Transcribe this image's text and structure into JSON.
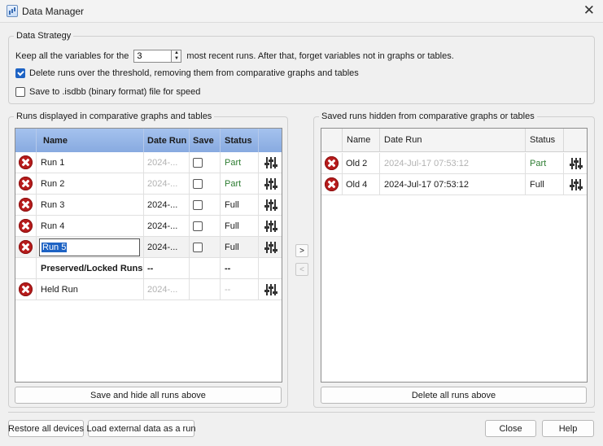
{
  "window": {
    "title": "Data Manager",
    "close": "✕"
  },
  "strategy": {
    "legend": "Data Strategy",
    "keep_prefix": "Keep all the variables for the",
    "keep_value": "3",
    "keep_suffix": "most recent runs.  After that, forget variables not in graphs or tables.",
    "delete_label": "Delete runs over the threshold, removing them from comparative graphs and tables",
    "delete_checked": true,
    "save_label": "Save to .isdbb (binary format) file for speed",
    "save_checked": false
  },
  "left": {
    "legend": "Runs displayed in comparative graphs and tables",
    "headers": {
      "name": "Name",
      "date": "Date Run",
      "save": "Save",
      "status": "Status"
    },
    "rows": [
      {
        "name": "Run 1",
        "date": "2024-...",
        "status": "Part"
      },
      {
        "name": "Run 2",
        "date": "2024-...",
        "status": "Part"
      },
      {
        "name": "Run 3",
        "date": "2024-...",
        "status": "Full"
      },
      {
        "name": "Run 4",
        "date": "2024-...",
        "status": "Full"
      },
      {
        "name": "Run 5",
        "date": "2024-...",
        "status": "Full"
      }
    ],
    "preserved": {
      "name": "Preserved/Locked Runs...",
      "date": "--",
      "status": "--"
    },
    "held": {
      "name": "Held Run",
      "date": "2024-...",
      "status": "--"
    },
    "button": "Save and hide all runs above"
  },
  "transfer": {
    "right": ">",
    "left": "<"
  },
  "right": {
    "legend": "Saved runs hidden from comparative graphs or tables",
    "headers": {
      "name": "Name",
      "date": "Date Run",
      "status": "Status"
    },
    "rows": [
      {
        "name": "Old 2",
        "date": "2024-Jul-17 07:53:12",
        "status": "Part"
      },
      {
        "name": "Old 4",
        "date": "2024-Jul-17 07:53:12",
        "status": "Full"
      }
    ],
    "button": "Delete all runs above"
  },
  "footer": {
    "restore": "Restore all devices",
    "load": "Load external data as a run",
    "close": "Close",
    "help": "Help"
  },
  "colors": {
    "header_blue": "#88aae0",
    "delete_red": "#b71c1c",
    "accent": "#1e63c4",
    "status_part": "#2e7d32"
  }
}
